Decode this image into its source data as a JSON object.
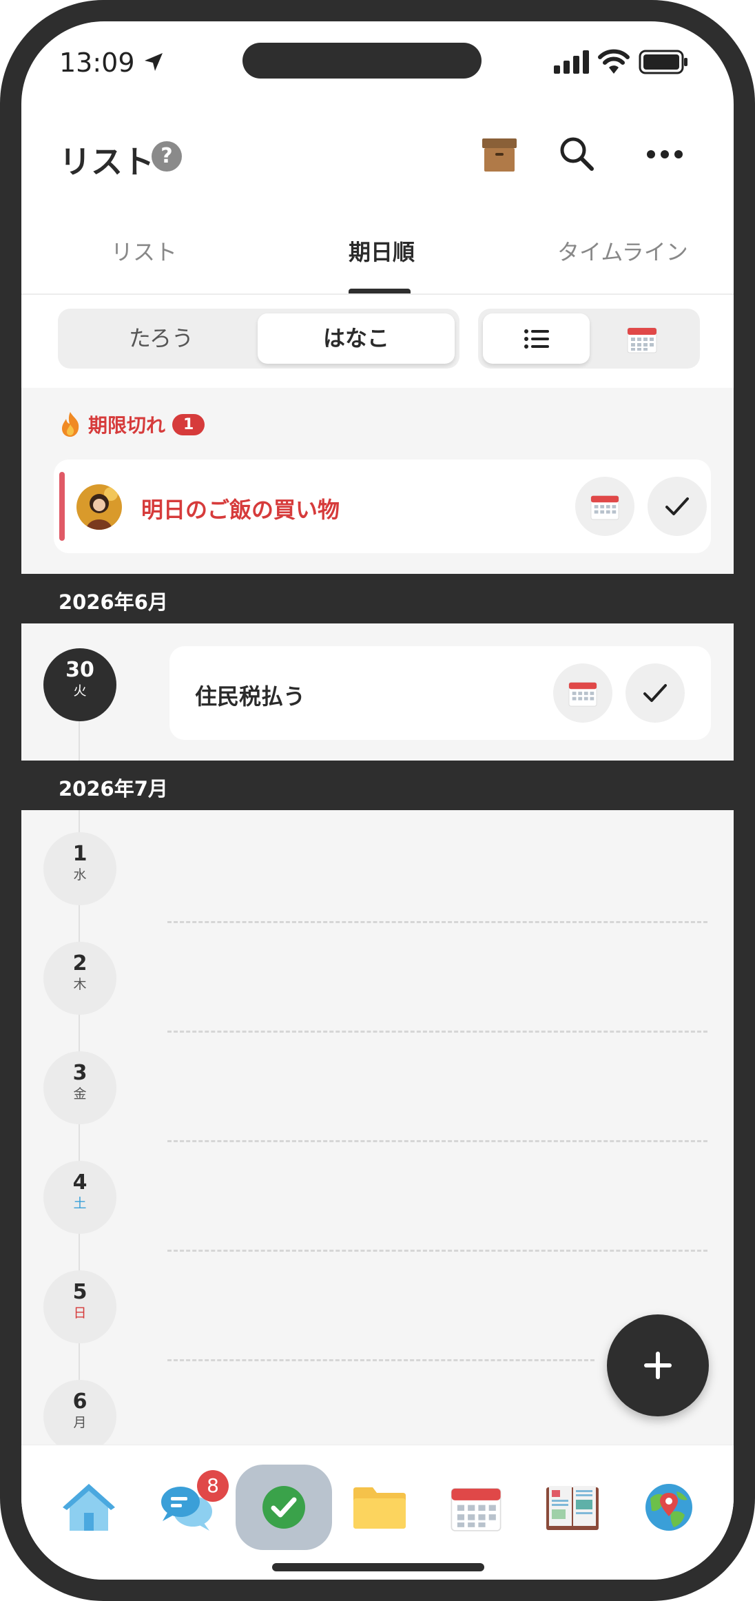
{
  "status_bar": {
    "time": "13:09"
  },
  "header": {
    "title": "リスト",
    "help": "?"
  },
  "tabs": [
    {
      "label": "リスト"
    },
    {
      "label": "期日順"
    },
    {
      "label": "タイムライン"
    }
  ],
  "user_switch": {
    "options": [
      "たろう",
      "はなこ"
    ],
    "selected": "はなこ"
  },
  "view_switch": {
    "selected": "list-icon"
  },
  "overdue": {
    "label": "期限切れ",
    "count": "1",
    "task": "明日のご飯の買い物"
  },
  "months": [
    {
      "label": "2026年6月"
    },
    {
      "label": "2026年7月"
    }
  ],
  "june_task": {
    "day": "30",
    "weekday": "火",
    "title": "住民税払う"
  },
  "july_days": [
    {
      "day": "1",
      "weekday": "水"
    },
    {
      "day": "2",
      "weekday": "木"
    },
    {
      "day": "3",
      "weekday": "金"
    },
    {
      "day": "4",
      "weekday": "土"
    },
    {
      "day": "5",
      "weekday": "日"
    },
    {
      "day": "6",
      "weekday": "月"
    }
  ],
  "nav": {
    "items": [
      "home-icon",
      "chat-icon",
      "check-icon",
      "folder-icon",
      "calendar-icon",
      "notebook-icon",
      "globe-map-icon"
    ],
    "chat_badge": "8",
    "active": "check-icon"
  },
  "colors": {
    "accent_red": "#d63b3b",
    "dark": "#2e2e2e",
    "active_nav": "#b9c3ce"
  }
}
